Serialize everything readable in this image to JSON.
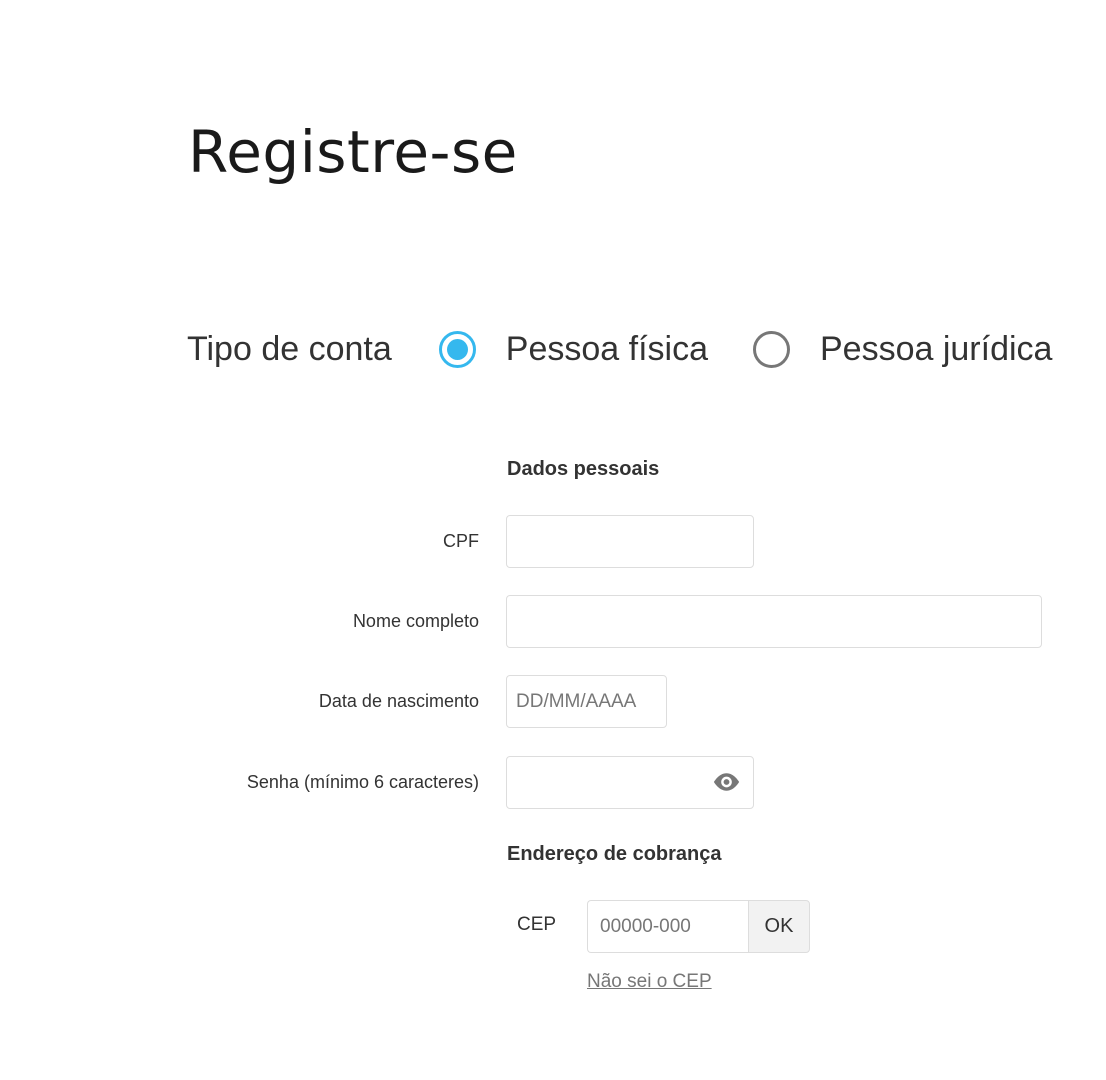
{
  "page": {
    "title": "Registre-se"
  },
  "account_type": {
    "label": "Tipo de conta",
    "options": [
      {
        "label": "Pessoa física",
        "selected": true
      },
      {
        "label": "Pessoa jurídica",
        "selected": false
      }
    ]
  },
  "personal_data": {
    "heading": "Dados pessoais",
    "fields": {
      "cpf": {
        "label": "CPF",
        "value": "",
        "placeholder": ""
      },
      "full_name": {
        "label": "Nome completo",
        "value": "",
        "placeholder": ""
      },
      "birth_date": {
        "label": "Data de nascimento",
        "value": "",
        "placeholder": "DD/MM/AAAA"
      },
      "password": {
        "label": "Senha (mínimo 6 caracteres)",
        "value": "",
        "placeholder": "",
        "toggle_icon": "eye-icon"
      }
    }
  },
  "billing_address": {
    "heading": "Endereço de cobrança",
    "cep_label": "CEP",
    "cep_value": "",
    "cep_placeholder": "00000-000",
    "ok_label": "OK",
    "unknown_cep_link": "Não sei o CEP"
  },
  "colors": {
    "accent": "#35b8ee",
    "text": "#333333",
    "muted": "#777777",
    "border": "#dddddd",
    "button_bg": "#f2f2f2"
  }
}
